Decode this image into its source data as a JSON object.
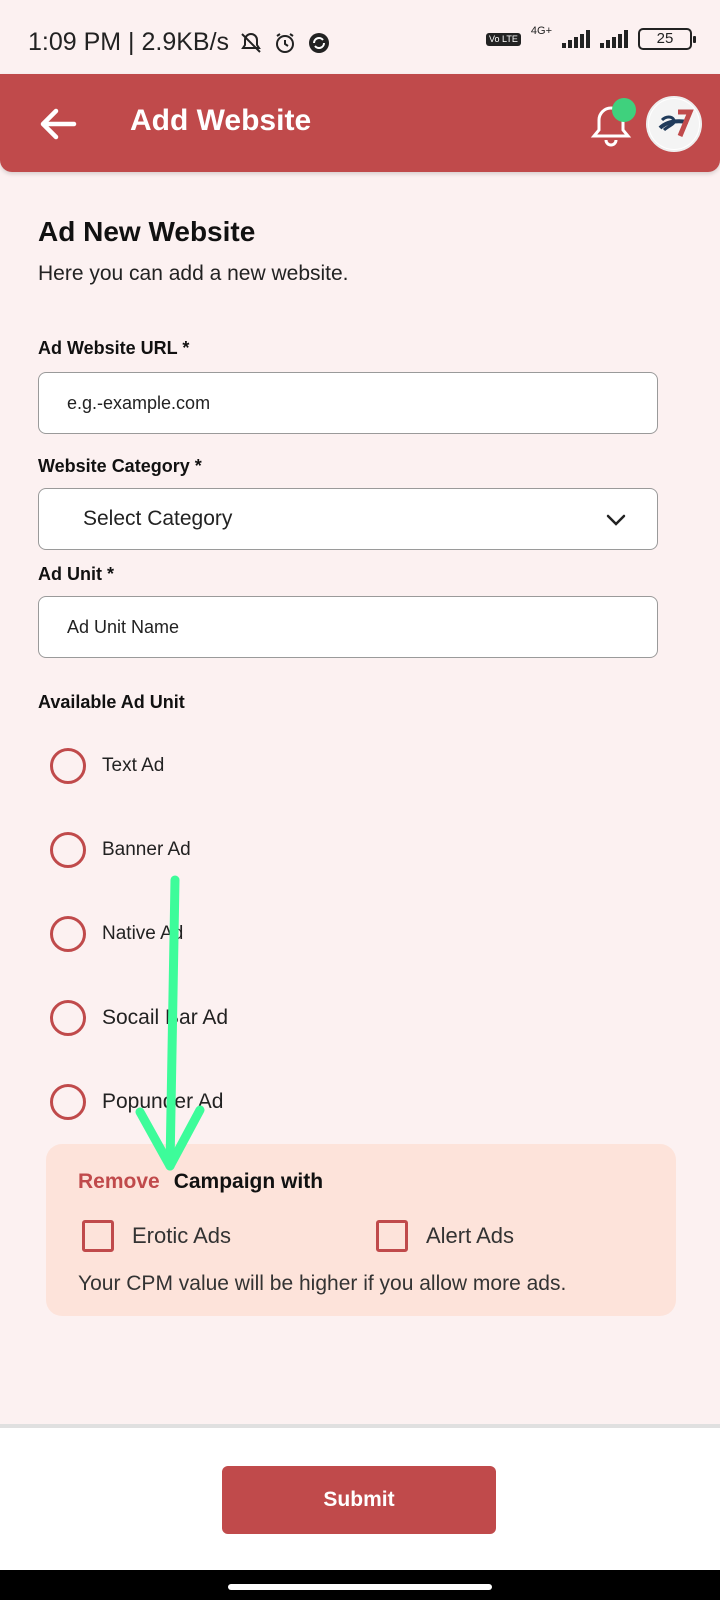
{
  "status_bar": {
    "time_speed": "1:09 PM | 2.9KB/s",
    "volte": "Vo LTE",
    "network": "4G+",
    "battery": "25"
  },
  "app_bar": {
    "title": "Add Website"
  },
  "form": {
    "heading": "Ad New Website",
    "subheading": "Here you can add a new website.",
    "url_label": "Ad Website URL *",
    "url_placeholder": "e.g.-example.com",
    "category_label": "Website Category *",
    "category_selected": "Select Category",
    "ad_unit_label": "Ad Unit *",
    "ad_unit_placeholder": "Ad Unit Name",
    "available_label": "Available Ad Unit",
    "ad_units": [
      "Text Ad",
      "Banner Ad",
      "Native Ad",
      "Socail Bar Ad",
      "Popunder Ad"
    ]
  },
  "campaign": {
    "remove": "Remove",
    "title": "Campaign with",
    "options": [
      "Erotic Ads",
      "Alert Ads"
    ],
    "note": "Your CPM value will be higher if you allow more ads."
  },
  "submit_label": "Submit",
  "colors": {
    "primary": "#c04a4b",
    "background": "#fcf1f1",
    "campaign_bg": "#fde3da",
    "badge": "#3fd17d",
    "annotation_arrow": "#3dfc9a"
  }
}
